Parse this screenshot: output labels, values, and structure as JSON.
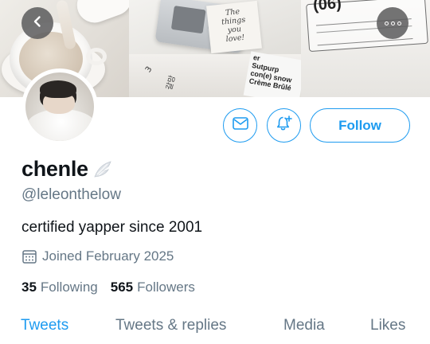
{
  "banner": {
    "note_lines": [
      "The",
      "things",
      "you",
      "love!"
    ],
    "tag_text": "3",
    "korean_text": "갈망",
    "book_lines": [
      "er",
      "Sutpurp",
      "con(e) snow",
      "Crème Brûlé"
    ],
    "brochure_number": "(06)"
  },
  "profile": {
    "display_name": "chenle",
    "handle": "@leleonthelow",
    "bio": "certified yapper since 2001",
    "joined": "Joined February 2025",
    "following_count": "35",
    "following_label": "Following",
    "followers_count": "565",
    "followers_label": "Followers"
  },
  "actions": {
    "follow_label": "Follow"
  },
  "tabs": [
    {
      "label": "Tweets",
      "active": true
    },
    {
      "label": "Tweets & replies",
      "active": false
    },
    {
      "label": "Media",
      "active": false
    },
    {
      "label": "Likes",
      "active": false
    }
  ],
  "icons": {
    "back": "chevron-left-icon",
    "more": "more-horizontal-icon",
    "mail": "mail-icon",
    "notify": "bell-plus-icon",
    "verified_wing": "wing-icon",
    "calendar": "calendar-icon"
  },
  "colors": {
    "accent": "#1d9bf0",
    "secondary_text": "#657786",
    "primary_text": "#0f1419"
  }
}
